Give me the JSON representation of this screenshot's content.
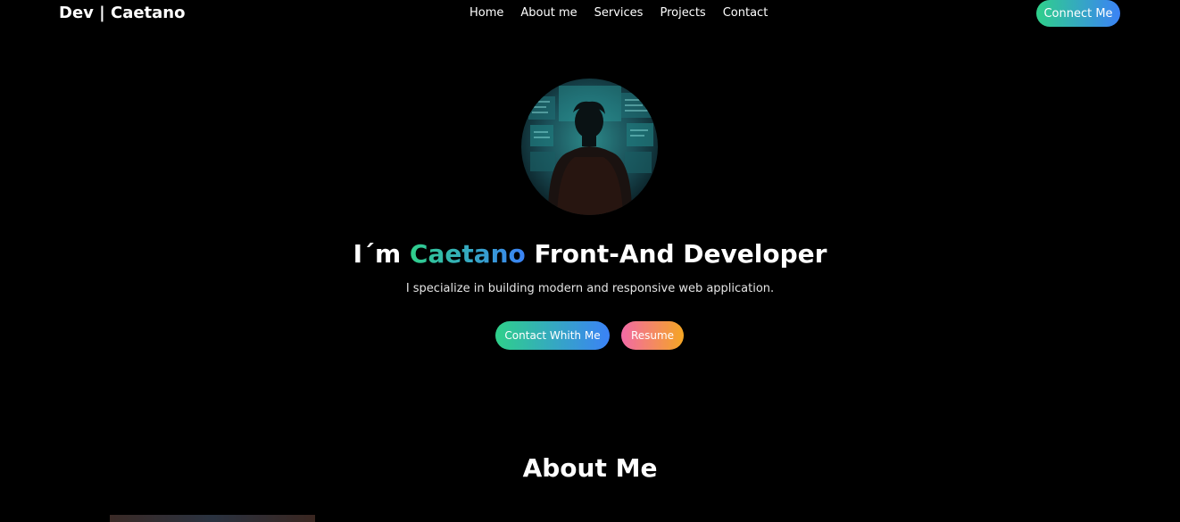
{
  "header": {
    "logo": "Dev | Caetano",
    "nav": [
      "Home",
      "About me",
      "Services",
      "Projects",
      "Contact"
    ],
    "connect_label": "Connect Me"
  },
  "hero": {
    "title_prefix": "I´m ",
    "title_name": "Caetano",
    "title_suffix": " Front-And Developer",
    "subtitle": "I specialize in building modern and responsive web application.",
    "contact_label": "Contact Whith Me",
    "resume_label": "Resume",
    "avatar_icon": "developer-silhouette-icon"
  },
  "about": {
    "title": "About Me"
  },
  "colors": {
    "background": "#000000",
    "accent_gradient_start": "#2fd08a",
    "accent_gradient_end": "#3b82f6",
    "resume_gradient_start": "#f26aa6",
    "resume_gradient_end": "#f5a623"
  }
}
